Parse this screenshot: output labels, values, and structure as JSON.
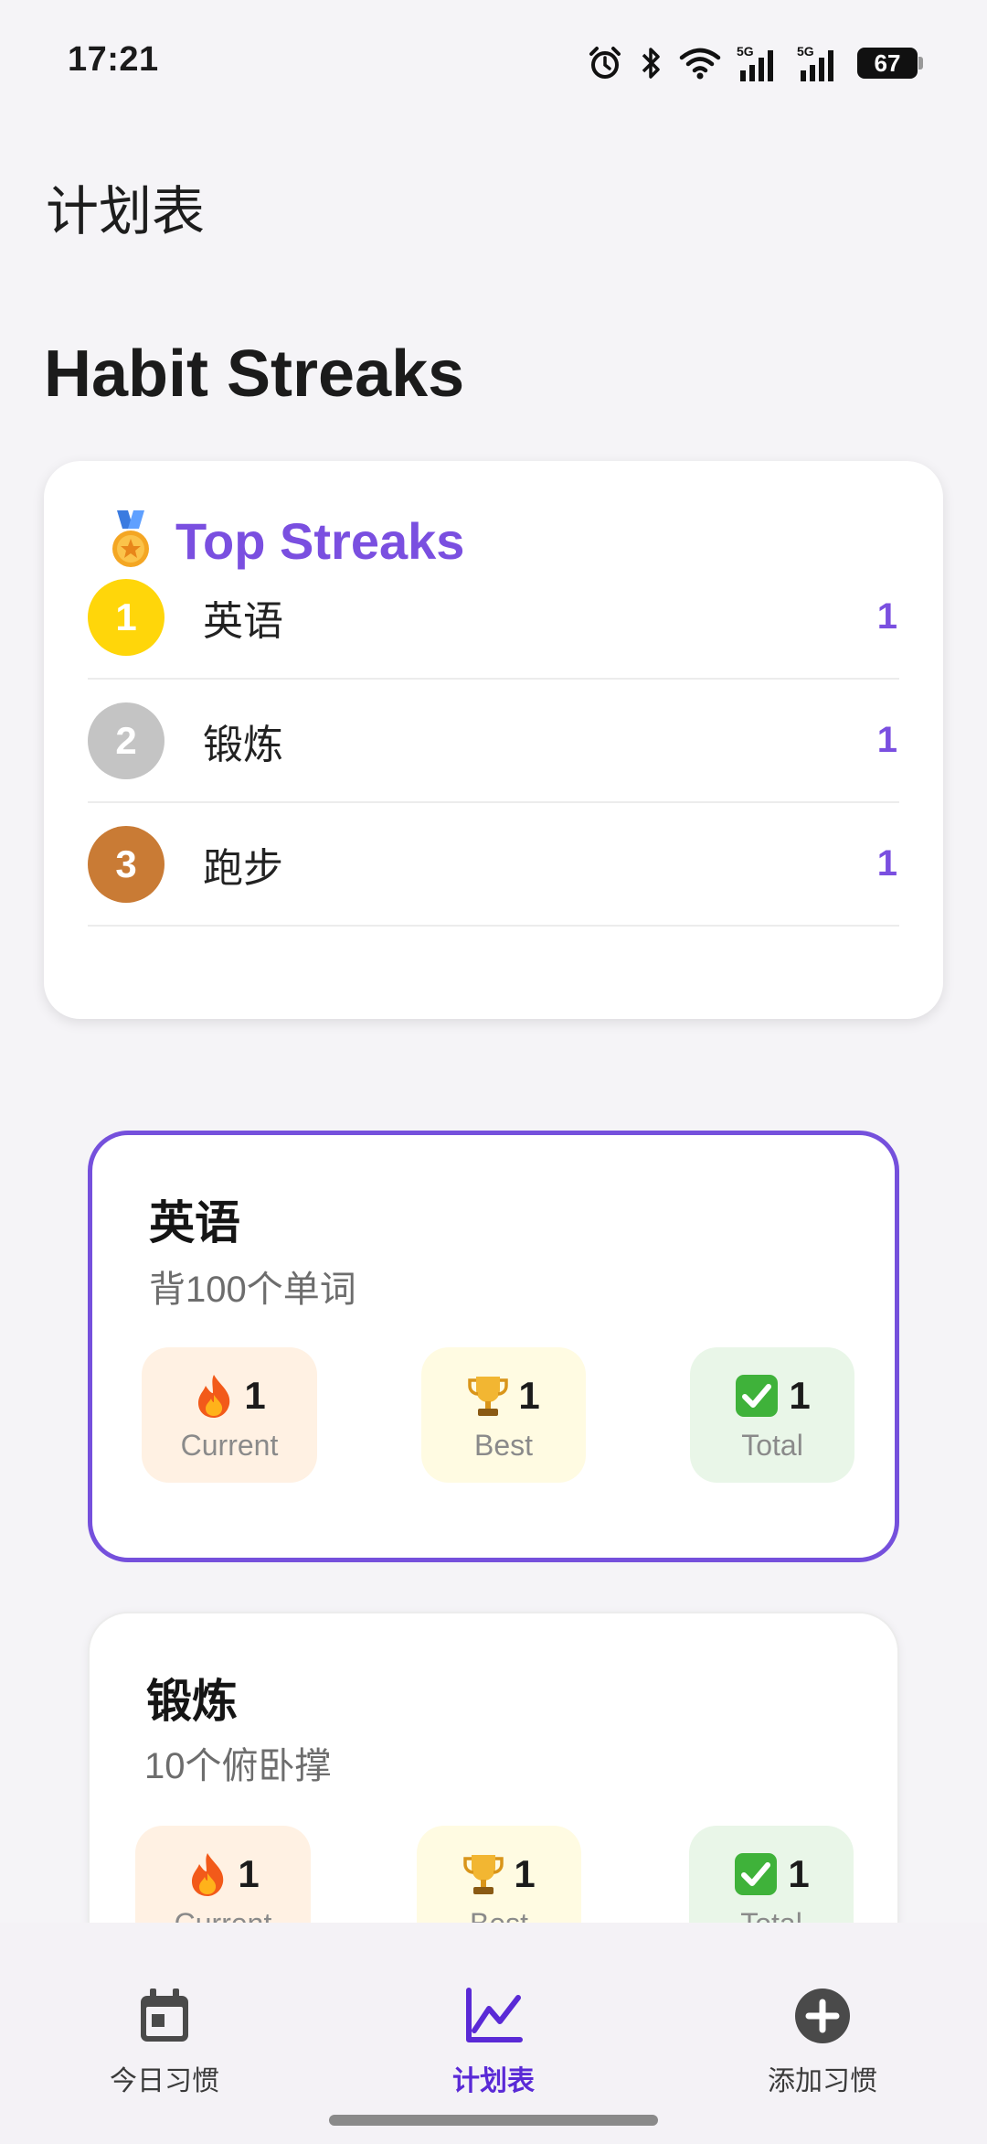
{
  "status_bar": {
    "time": "17:21",
    "battery": "67",
    "signal_label": "5G"
  },
  "app_title": "计划表",
  "page_heading": "Habit Streaks",
  "top_streaks": {
    "title": "Top Streaks",
    "icon": "medal-icon",
    "items": [
      {
        "rank": "1",
        "name": "英语",
        "value": "1",
        "color": "#FFD60A"
      },
      {
        "rank": "2",
        "name": "锻炼",
        "value": "1",
        "color": "#C4C4C4"
      },
      {
        "rank": "3",
        "name": "跑步",
        "value": "1",
        "color": "#C97B35"
      }
    ]
  },
  "habits": [
    {
      "name": "英语",
      "description": "背100个单词",
      "selected": true,
      "stats": {
        "current": {
          "value": "1",
          "label": "Current",
          "icon": "fire-icon"
        },
        "best": {
          "value": "1",
          "label": "Best",
          "icon": "trophy-icon"
        },
        "total": {
          "value": "1",
          "label": "Total",
          "icon": "check-icon"
        }
      }
    },
    {
      "name": "锻炼",
      "description": "10个俯卧撑",
      "selected": false,
      "stats": {
        "current": {
          "value": "1",
          "label": "Current",
          "icon": "fire-icon"
        },
        "best": {
          "value": "1",
          "label": "Best",
          "icon": "trophy-icon"
        },
        "total": {
          "value": "1",
          "label": "Total",
          "icon": "check-icon"
        }
      }
    }
  ],
  "bottom_nav": {
    "items": [
      {
        "label": "今日习惯",
        "icon": "calendar-icon",
        "active": false
      },
      {
        "label": "计划表",
        "icon": "chart-line-icon",
        "active": true
      },
      {
        "label": "添加习惯",
        "icon": "add-circle-icon",
        "active": false
      }
    ]
  },
  "colors": {
    "accent": "#7A4FE0",
    "nav_active": "#5A2AD6",
    "background": "#F5F4F7"
  }
}
